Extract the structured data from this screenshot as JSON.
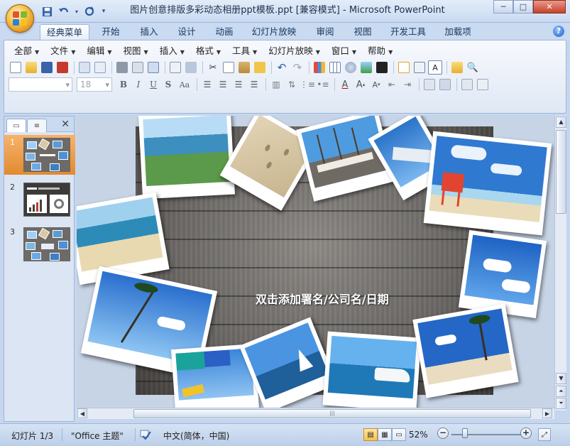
{
  "window": {
    "title": "图片创意排版多彩动态相册ppt模板.ppt [兼容模式] - Microsoft PowerPoint",
    "minimize": "─",
    "restore": "□",
    "close": "✕"
  },
  "quick_access": {
    "save": "💾",
    "undo": "↶",
    "redo": "↻",
    "customize": "▾"
  },
  "tabs": [
    "经典菜单",
    "开始",
    "插入",
    "设计",
    "动画",
    "幻灯片放映",
    "审阅",
    "视图",
    "开发工具",
    "加载项"
  ],
  "active_tab": "经典菜单",
  "help": "?",
  "menu": [
    "全部",
    "文件",
    "编辑",
    "视图",
    "插入",
    "格式",
    "工具",
    "幻灯片放映",
    "窗口",
    "帮助"
  ],
  "format_bar": {
    "font_name": "",
    "font_size": "18",
    "bold": "B",
    "italic": "I",
    "underline": "U",
    "shadow": "S",
    "change_case": "Aa"
  },
  "left_panel": {
    "tab_slides": "▭",
    "tab_outline": "≡",
    "close": "✕",
    "slides": [
      {
        "num": "1",
        "selected": true
      },
      {
        "num": "2",
        "selected": false
      },
      {
        "num": "3",
        "selected": false
      }
    ]
  },
  "slide": {
    "caption": "双击添加署名/公司名/日期"
  },
  "statusbar": {
    "slide_info": "幻灯片 1/3",
    "theme": "\"Office 主题\"",
    "language": "中文(简体，中国)",
    "zoom": "52%",
    "zoom_level": 0.52,
    "zoom_out": "−",
    "zoom_in": "+"
  },
  "colors": {
    "ribbon_bg": "#dfe8f5",
    "accent_selected": "#e28a2f",
    "titlebar": "#c9daf1"
  }
}
